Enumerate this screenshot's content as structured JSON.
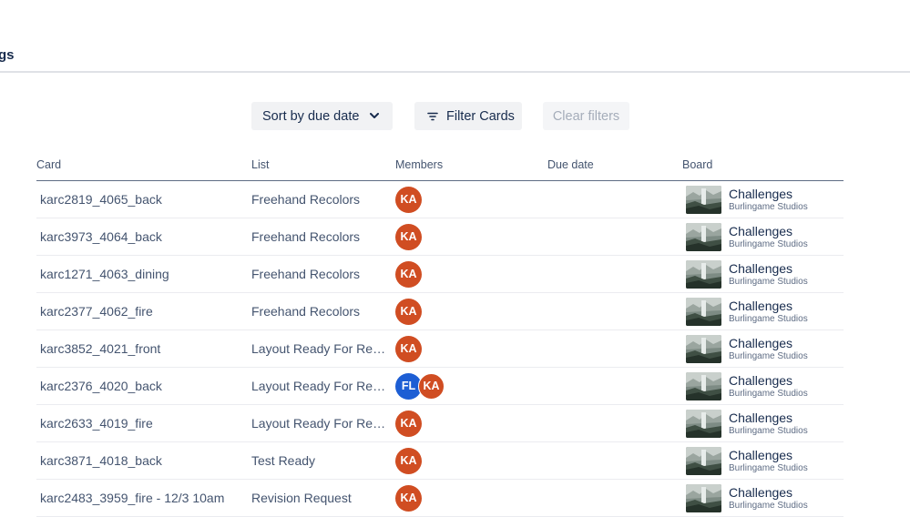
{
  "header": {
    "title_fragment": "gs"
  },
  "toolbar": {
    "sort_label": "Sort by due date",
    "filter_label": "Filter Cards",
    "clear_label": "Clear filters"
  },
  "table": {
    "columns": {
      "card": "Card",
      "list": "List",
      "members": "Members",
      "due_date": "Due date",
      "board": "Board"
    },
    "rows": [
      {
        "card": "karc2819_4065_back",
        "list": "Freehand Recolors",
        "members": [
          "KA"
        ],
        "board": "Challenges",
        "workspace": "Burlingame Studios"
      },
      {
        "card": "karc3973_4064_back",
        "list": "Freehand Recolors",
        "members": [
          "KA"
        ],
        "board": "Challenges",
        "workspace": "Burlingame Studios"
      },
      {
        "card": "karc1271_4063_dining",
        "list": "Freehand Recolors",
        "members": [
          "KA"
        ],
        "board": "Challenges",
        "workspace": "Burlingame Studios"
      },
      {
        "card": "karc2377_4062_fire",
        "list": "Freehand Recolors",
        "members": [
          "KA"
        ],
        "board": "Challenges",
        "workspace": "Burlingame Studios"
      },
      {
        "card": "karc3852_4021_front",
        "list": "Layout Ready For Revi…",
        "members": [
          "KA"
        ],
        "board": "Challenges",
        "workspace": "Burlingame Studios"
      },
      {
        "card": "karc2376_4020_back",
        "list": "Layout Ready For Revi…",
        "members": [
          "FL",
          "KA"
        ],
        "board": "Challenges",
        "workspace": "Burlingame Studios"
      },
      {
        "card": "karc2633_4019_fire",
        "list": "Layout Ready For Revi…",
        "members": [
          "KA"
        ],
        "board": "Challenges",
        "workspace": "Burlingame Studios"
      },
      {
        "card": "karc3871_4018_back",
        "list": "Test Ready",
        "members": [
          "KA"
        ],
        "board": "Challenges",
        "workspace": "Burlingame Studios"
      },
      {
        "card": "karc2483_3959_fire - 12/3 10am",
        "list": "Revision Request",
        "members": [
          "KA"
        ],
        "board": "Challenges",
        "workspace": "Burlingame Studios"
      }
    ]
  },
  "colors": {
    "KA": "#d04d22",
    "FL": "#1d5ed4"
  },
  "icons": {
    "sort": "chevron-down-icon",
    "filter": "filter-lines-icon",
    "board": "board-thumbnail-icon"
  }
}
